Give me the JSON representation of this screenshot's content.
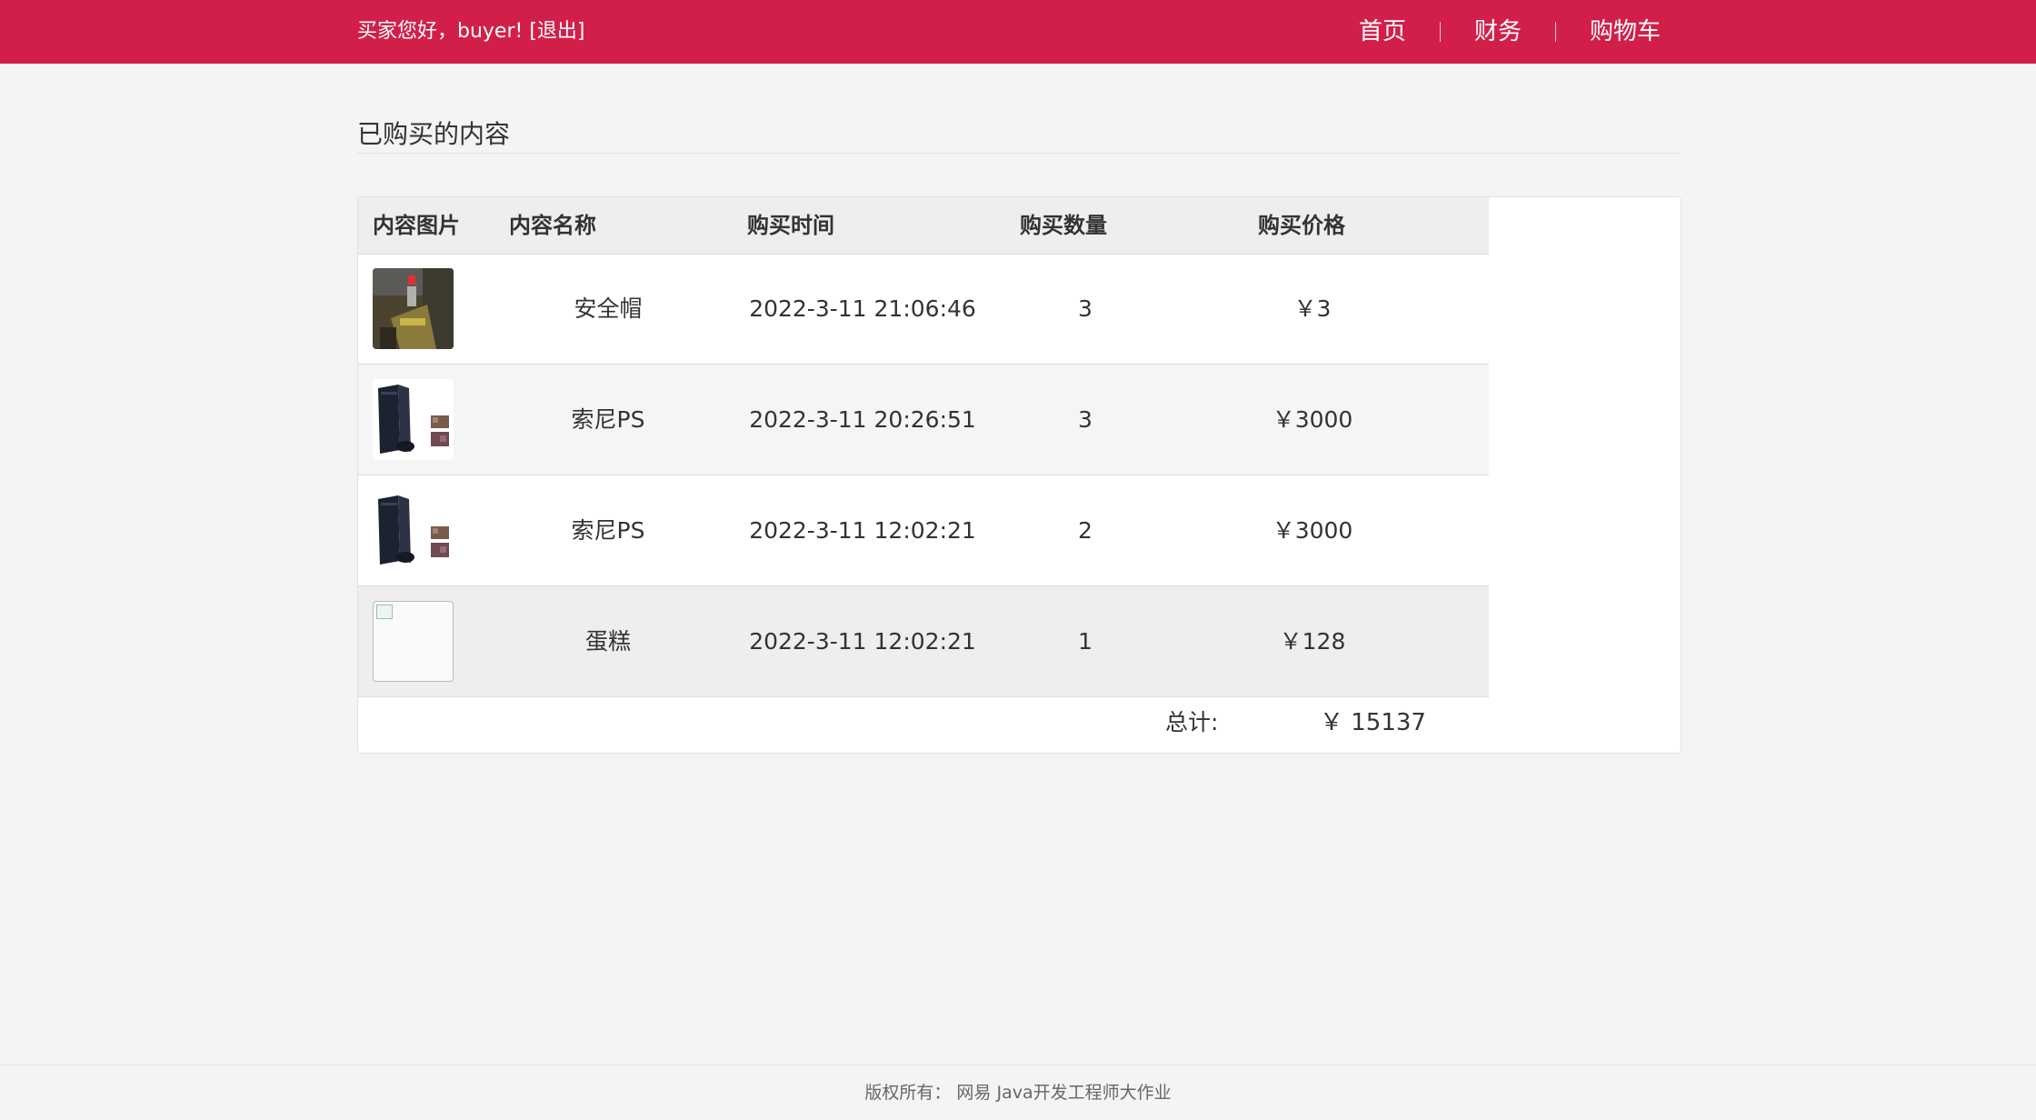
{
  "header": {
    "greeting": "买家您好，buyer!",
    "logout": "[退出]",
    "nav": [
      "首页",
      "财务",
      "购物车"
    ]
  },
  "page": {
    "title": "已购买的内容"
  },
  "table": {
    "columns": [
      "内容图片",
      "内容名称",
      "购买时间",
      "购买数量",
      "购买价格"
    ],
    "rows": [
      {
        "image": "hard-hat-photo",
        "name": "安全帽",
        "time": "2022-3-11 21:06:46",
        "qty": "3",
        "price": "￥3"
      },
      {
        "image": "ps4-console-photo",
        "name": "索尼PS",
        "time": "2022-3-11 20:26:51",
        "qty": "3",
        "price": "￥3000"
      },
      {
        "image": "ps4-console-photo",
        "name": "索尼PS",
        "time": "2022-3-11 12:02:21",
        "qty": "2",
        "price": "￥3000"
      },
      {
        "image": "broken-image",
        "name": "蛋糕",
        "time": "2022-3-11 12:02:21",
        "qty": "1",
        "price": "￥128"
      }
    ],
    "total_label": "总计:",
    "total_value": "￥ 15137"
  },
  "footer": {
    "text": "版权所有： 网易 Java开发工程师大作业"
  },
  "colors": {
    "brand": "#d21f49",
    "background": "#f4f4f4"
  }
}
